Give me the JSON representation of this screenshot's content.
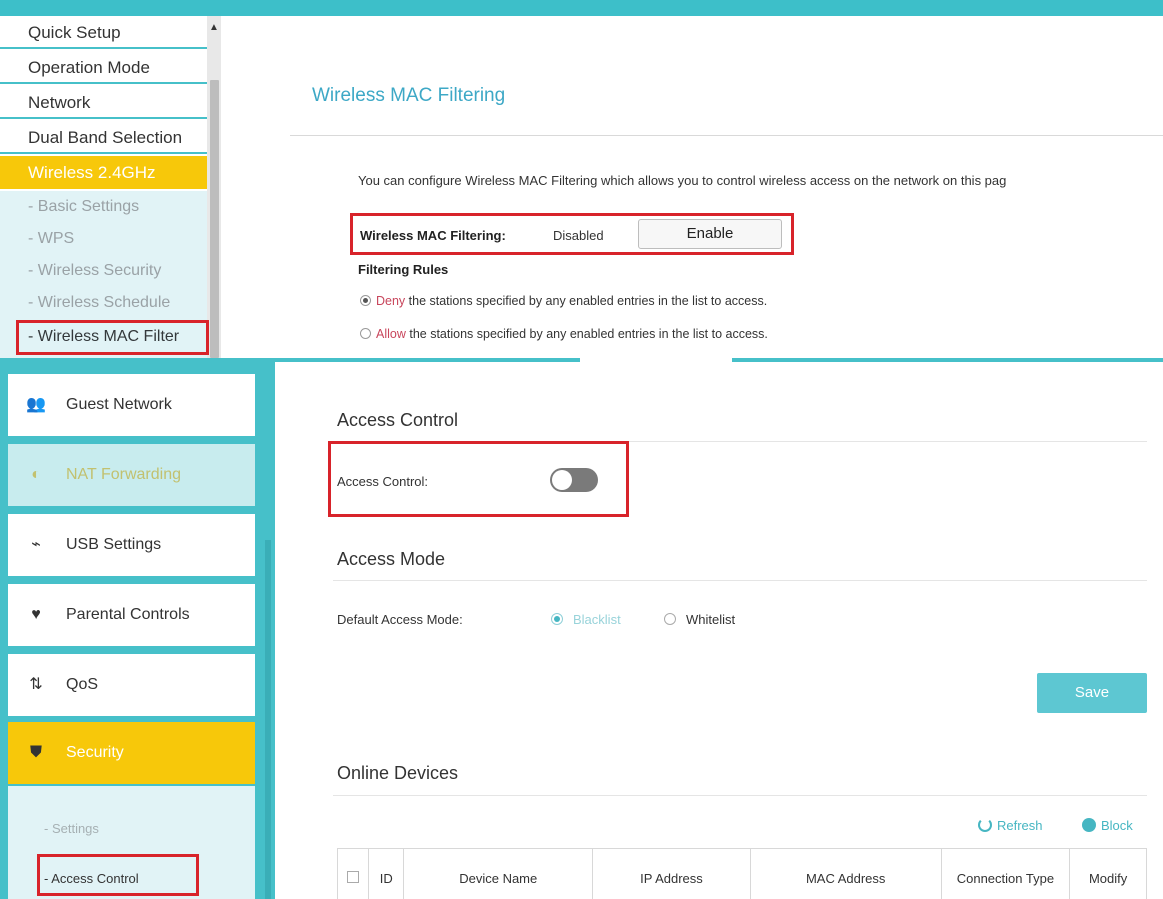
{
  "top_panel": {
    "nav": [
      {
        "label": "Quick Setup"
      },
      {
        "label": "Operation Mode"
      },
      {
        "label": "Network"
      },
      {
        "label": "Dual Band Selection"
      },
      {
        "label": "Wireless 2.4GHz"
      }
    ],
    "sub_nav": [
      {
        "label": "- Basic Settings"
      },
      {
        "label": "- WPS"
      },
      {
        "label": "- Wireless Security"
      },
      {
        "label": "- Wireless Schedule"
      },
      {
        "label": "- Wireless MAC Filter"
      }
    ],
    "scroll_up_glyph": "▲",
    "title": "Wireless MAC Filtering",
    "description": "You can configure Wireless MAC Filtering which allows you to control wireless access on the network on this pag",
    "filter_label": "Wireless MAC Filtering:",
    "filter_status": "Disabled",
    "enable_button": "Enable",
    "rules_label": "Filtering Rules",
    "rule_deny_keyword": "Deny",
    "rule_deny_text": " the stations specified by any enabled entries in the list to access.",
    "rule_allow_keyword": "Allow",
    "rule_allow_text": " the stations specified by any enabled entries in the list to access."
  },
  "bottom_panel": {
    "nav": [
      {
        "label": "Guest Network",
        "icon": "guest-network-icon",
        "glyph": "👥"
      },
      {
        "label": "NAT Forwarding",
        "icon": "nat-forwarding-icon",
        "glyph": "◐"
      },
      {
        "label": "USB Settings",
        "icon": "usb-icon",
        "glyph": "⌁"
      },
      {
        "label": "Parental Controls",
        "icon": "parental-controls-icon",
        "glyph": "♥"
      },
      {
        "label": "QoS",
        "icon": "qos-icon",
        "glyph": "⇅"
      },
      {
        "label": "Security",
        "icon": "shield-icon",
        "glyph": "⛊"
      }
    ],
    "sub_nav": [
      {
        "label": "- Settings"
      },
      {
        "label": "- Access Control"
      }
    ],
    "access_control": {
      "section_title": "Access Control",
      "label": "Access Control:",
      "enabled": false
    },
    "access_mode": {
      "section_title": "Access Mode",
      "label": "Default Access Mode:",
      "options": [
        "Blacklist",
        "Whitelist"
      ],
      "selected": "Blacklist"
    },
    "save_button": "Save",
    "online_devices": {
      "section_title": "Online Devices",
      "refresh_label": "Refresh",
      "block_label": "Block",
      "columns": [
        "ID",
        "Device Name",
        "IP Address",
        "MAC Address",
        "Connection Type",
        "Modify"
      ]
    }
  },
  "colors": {
    "accent_teal": "#46c0c9",
    "active_yellow": "#f7c80a",
    "highlight_red": "#d8232a"
  }
}
